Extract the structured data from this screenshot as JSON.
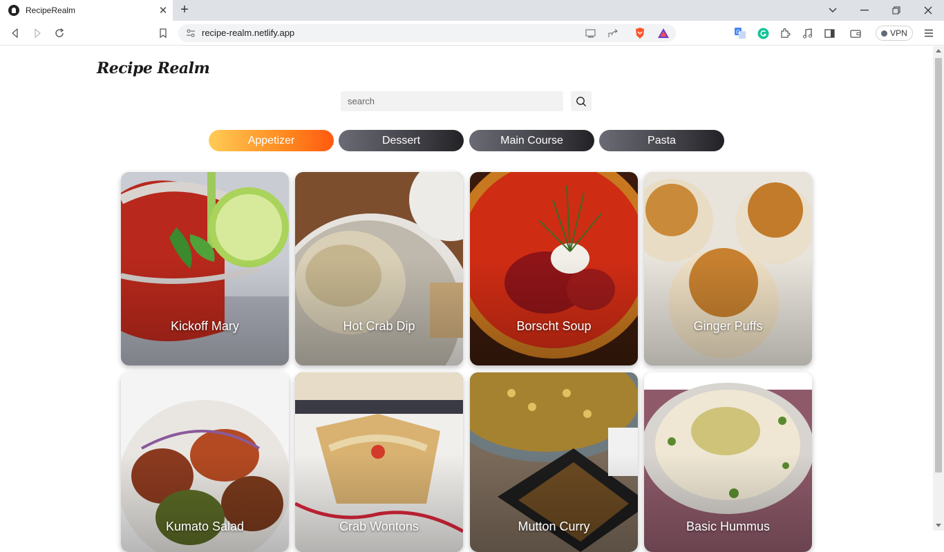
{
  "browser": {
    "tab_title": "RecipeRealm",
    "url": "recipe-realm.netlify.app",
    "vpn_label": "VPN"
  },
  "page": {
    "logo": "Recipe Realm",
    "search": {
      "placeholder": "search",
      "value": ""
    },
    "categories": [
      {
        "label": "Appetizer",
        "active": true
      },
      {
        "label": "Dessert",
        "active": false
      },
      {
        "label": "Main Course",
        "active": false
      },
      {
        "label": "Pasta",
        "active": false
      }
    ],
    "recipes": [
      {
        "title": "Kickoff Mary"
      },
      {
        "title": "Hot Crab Dip"
      },
      {
        "title": "Borscht Soup"
      },
      {
        "title": "Ginger Puffs"
      },
      {
        "title": "Kumato Salad"
      },
      {
        "title": "Crab Wontons"
      },
      {
        "title": "Mutton Curry"
      },
      {
        "title": "Basic Hummus"
      }
    ]
  },
  "colors": {
    "active_category": "#ff8a20",
    "inactive_category": "#3a3a40"
  }
}
